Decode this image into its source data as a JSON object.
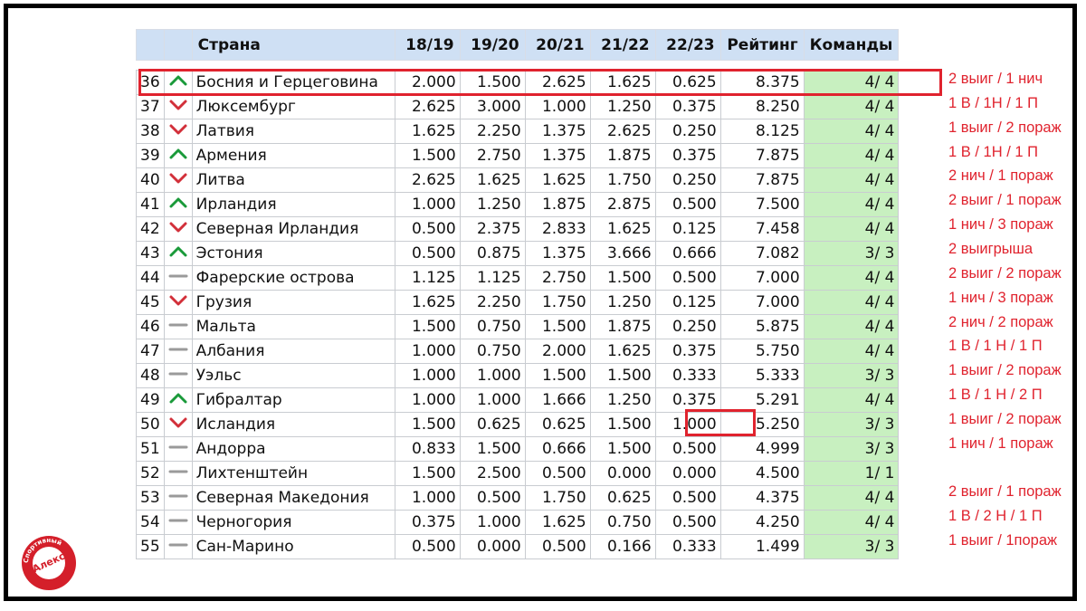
{
  "table": {
    "headers": {
      "country": "Страна",
      "s1": "18/19",
      "s2": "19/20",
      "s3": "20/21",
      "s4": "21/22",
      "s5": "22/23",
      "rating": "Рейтинг",
      "teams": "Команды"
    },
    "rows": [
      {
        "pos": "36",
        "trend": "up",
        "country": "Босния и Герцеговина",
        "s1": "2.000",
        "s2": "1.500",
        "s3": "2.625",
        "s4": "1.625",
        "s5": "0.625",
        "rating": "8.375",
        "teams": "4/ 4",
        "note": "2 выиг / 1 нич"
      },
      {
        "pos": "37",
        "trend": "down",
        "country": " Люксембург",
        "s1": "2.625",
        "s2": "3.000",
        "s3": "1.000",
        "s4": "1.250",
        "s5": "0.375",
        "rating": "8.250",
        "teams": "4/ 4",
        "note": "1 В  / 1Н / 1 П"
      },
      {
        "pos": "38",
        "trend": "down",
        "country": "Латвия",
        "s1": "1.625",
        "s2": "2.250",
        "s3": "1.375",
        "s4": "2.625",
        "s5": "0.250",
        "rating": "8.125",
        "teams": "4/ 4",
        "note": "1 выиг / 2 пораж"
      },
      {
        "pos": "39",
        "trend": "up",
        "country": "Армения",
        "s1": "1.500",
        "s2": "2.750",
        "s3": "1.375",
        "s4": "1.875",
        "s5": "0.375",
        "rating": "7.875",
        "teams": "4/ 4",
        "note": "1 В  / 1Н / 1 П"
      },
      {
        "pos": "40",
        "trend": "down",
        "country": "Литва",
        "s1": "2.625",
        "s2": "1.625",
        "s3": "1.625",
        "s4": "1.750",
        "s5": "0.250",
        "rating": "7.875",
        "teams": "4/ 4",
        "note": "2 нич / 1 пораж"
      },
      {
        "pos": "41",
        "trend": "up",
        "country": "Ирландия",
        "s1": "1.000",
        "s2": "1.250",
        "s3": "1.875",
        "s4": "2.875",
        "s5": "0.500",
        "rating": "7.500",
        "teams": "4/ 4",
        "note": "2 выиг / 1 пораж"
      },
      {
        "pos": "42",
        "trend": "down",
        "country": "Северная Ирландия",
        "s1": "0.500",
        "s2": "2.375",
        "s3": "2.833",
        "s4": "1.625",
        "s5": "0.125",
        "rating": "7.458",
        "teams": "4/ 4",
        "note": "1 нич / 3 пораж"
      },
      {
        "pos": "43",
        "trend": "up",
        "country": "Эстония",
        "s1": "0.500",
        "s2": "0.875",
        "s3": "1.375",
        "s4": "3.666",
        "s5": "0.666",
        "rating": "7.082",
        "teams": "3/ 3",
        "note": "2 выигрыша"
      },
      {
        "pos": "44",
        "trend": "flat",
        "country": "Фарерские острова",
        "s1": "1.125",
        "s2": "1.125",
        "s3": "2.750",
        "s4": "1.500",
        "s5": "0.500",
        "rating": "7.000",
        "teams": "4/ 4",
        "note": "2 выиг / 2 пораж"
      },
      {
        "pos": "45",
        "trend": "down",
        "country": "Грузия",
        "s1": "1.625",
        "s2": "2.250",
        "s3": "1.750",
        "s4": "1.250",
        "s5": "0.125",
        "rating": "7.000",
        "teams": "4/ 4",
        "note": "1 нич / 3 пораж"
      },
      {
        "pos": "46",
        "trend": "flat",
        "country": "Мальта",
        "s1": "1.500",
        "s2": "0.750",
        "s3": "1.500",
        "s4": "1.875",
        "s5": "0.250",
        "rating": "5.875",
        "teams": "4/ 4",
        "note": "2 нич / 2 пораж"
      },
      {
        "pos": "47",
        "trend": "flat",
        "country": "Албания",
        "s1": "1.000",
        "s2": "0.750",
        "s3": "2.000",
        "s4": "1.625",
        "s5": "0.375",
        "rating": "5.750",
        "teams": "4/ 4",
        "note": "1 В / 1 Н / 1 П"
      },
      {
        "pos": "48",
        "trend": "flat",
        "country": "Уэльс",
        "s1": "1.000",
        "s2": "1.000",
        "s3": "1.500",
        "s4": "1.500",
        "s5": "0.333",
        "rating": "5.333",
        "teams": "3/ 3",
        "note": "1 выиг / 2 пораж"
      },
      {
        "pos": "49",
        "trend": "up",
        "country": "Гибралтар",
        "s1": "1.000",
        "s2": "1.000",
        "s3": "1.666",
        "s4": "1.250",
        "s5": "0.375",
        "rating": "5.291",
        "teams": "4/ 4",
        "note": "1 В / 1 Н / 2 П"
      },
      {
        "pos": "50",
        "trend": "down",
        "country": "Исландия",
        "s1": "1.500",
        "s2": "0.625",
        "s3": "0.625",
        "s4": "1.500",
        "s5": "1.000",
        "rating": "5.250",
        "teams": "3/ 3",
        "note": "1 выиг / 2 пораж"
      },
      {
        "pos": "51",
        "trend": "flat",
        "country": " Андорра",
        "s1": "0.833",
        "s2": "1.500",
        "s3": "0.666",
        "s4": "1.500",
        "s5": "0.500",
        "rating": "4.999",
        "teams": "3/ 3",
        "note": "1 нич / 1 пораж"
      },
      {
        "pos": "52",
        "trend": "flat",
        "country": " Лихтенштейн",
        "s1": "1.500",
        "s2": "2.500",
        "s3": "0.500",
        "s4": "0.000",
        "s5": "0.000",
        "rating": "4.500",
        "teams": "1/ 1",
        "note": ""
      },
      {
        "pos": "53",
        "trend": "flat",
        "country": "Северная Македония",
        "s1": "1.000",
        "s2": "0.500",
        "s3": "1.750",
        "s4": "0.625",
        "s5": "0.500",
        "rating": "4.375",
        "teams": "4/ 4",
        "note": "2 выиг / 1 пораж"
      },
      {
        "pos": "54",
        "trend": "flat",
        "country": "Черногория",
        "s1": "0.375",
        "s2": "1.000",
        "s3": "1.625",
        "s4": "0.750",
        "s5": "0.500",
        "rating": "4.250",
        "teams": "4/ 4",
        "note": "1 В / 2 Н / 1 П"
      },
      {
        "pos": "55",
        "trend": "flat",
        "country": "Сан-Марино",
        "s1": "0.500",
        "s2": "0.000",
        "s3": "0.500",
        "s4": "0.166",
        "s5": "0.333",
        "rating": "1.499",
        "teams": "3/ 3",
        "note": "1 выиг / 1пораж"
      }
    ]
  },
  "logo": {
    "text": "Алекс",
    "ring_text": "Спортивный"
  },
  "colors": {
    "up": "#1a9a3a",
    "down": "#d2303a",
    "flat": "#9a9a9a",
    "accent": "#e0232e",
    "teams_bg": "#c8f0c0",
    "header_bg": "#cfe0f4"
  }
}
